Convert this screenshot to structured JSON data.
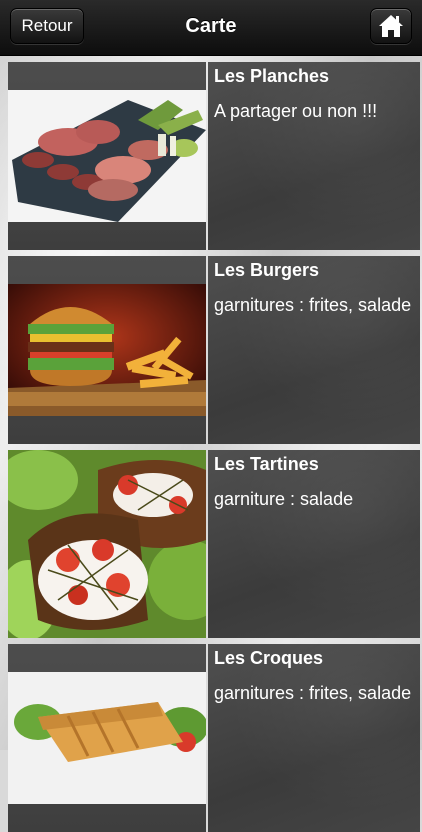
{
  "navbar": {
    "back_label": "Retour",
    "title": "Carte",
    "home_icon": "home-icon"
  },
  "menu": {
    "items": [
      {
        "title": "Les Planches",
        "description": "A partager ou non !!!"
      },
      {
        "title": "Les Burgers",
        "description": "garnitures : frites, salade"
      },
      {
        "title": "Les Tartines",
        "description": "garniture : salade"
      },
      {
        "title": "Les Croques",
        "description": "garnitures : frites, salade"
      }
    ]
  }
}
